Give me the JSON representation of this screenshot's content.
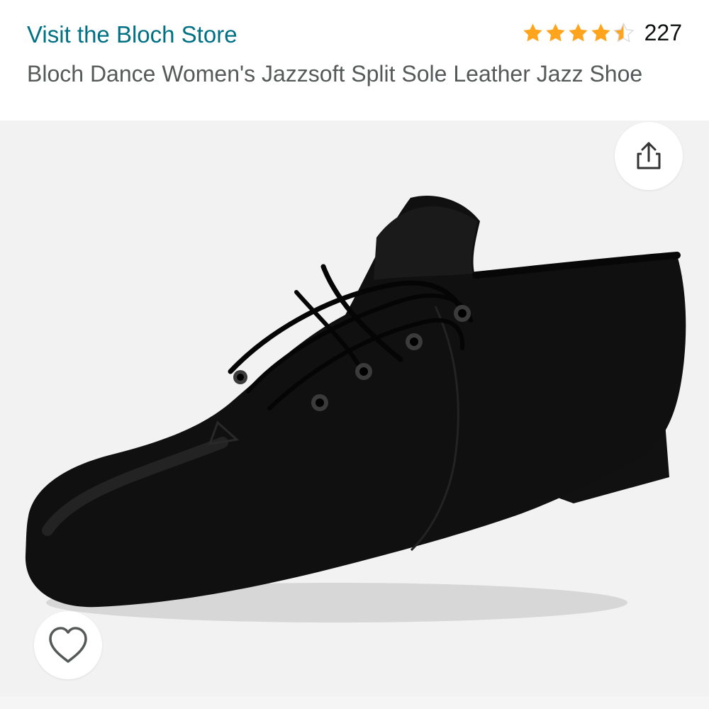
{
  "store": {
    "link_label": "Visit the Bloch Store"
  },
  "rating": {
    "stars_value": 4.5,
    "review_count": "227",
    "star_color": "#FFA41C"
  },
  "product": {
    "title": "Bloch Dance Women's Jazzsoft Split Sole Leather Jazz Shoe",
    "image_subject": "black leather lace-up jazz shoe"
  },
  "actions": {
    "share_icon": "share-icon",
    "wishlist_icon": "heart-icon"
  },
  "colors": {
    "link": "#007185",
    "title": "#565959",
    "image_background": "#f2f2f2"
  }
}
